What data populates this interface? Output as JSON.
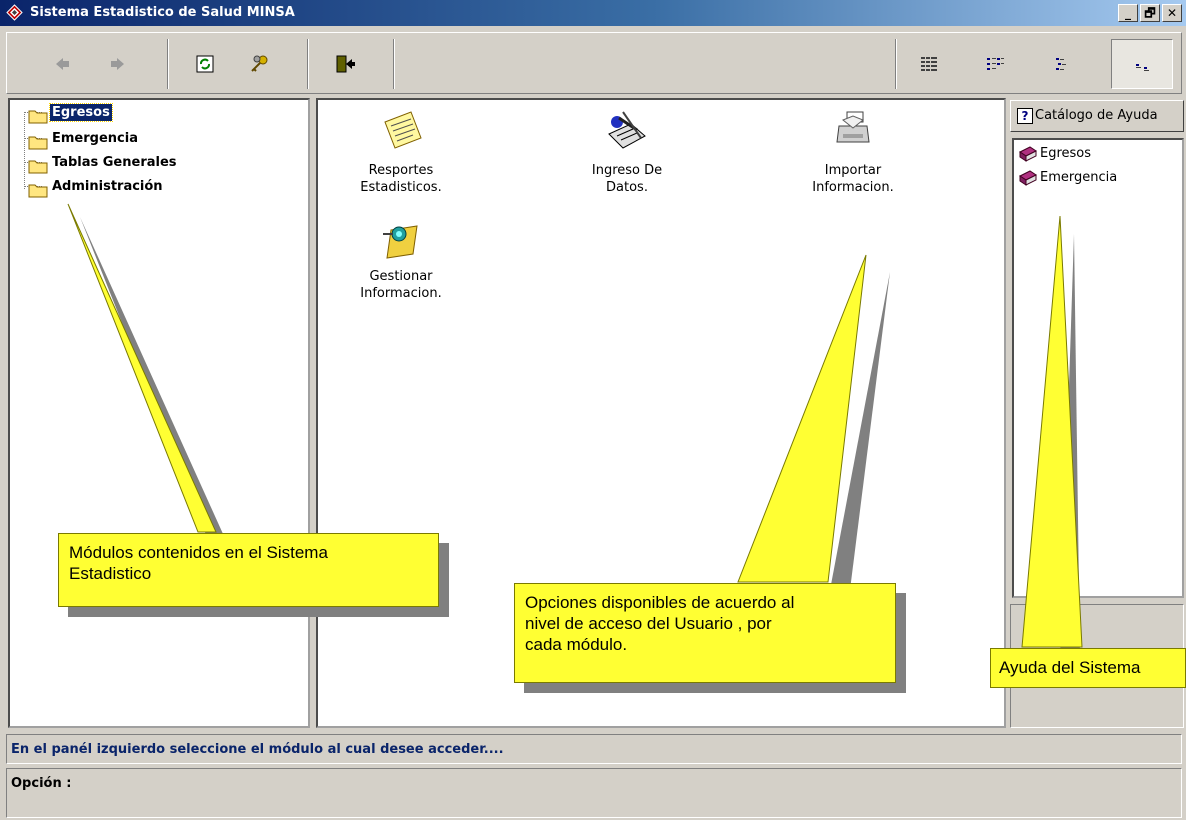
{
  "window": {
    "title": "Sistema Estadistico de Salud  MINSA",
    "minimize_label": "_",
    "maximize_label": "🗗",
    "close_label": "✕"
  },
  "toolbar": {
    "buttons": [
      {
        "name": "back",
        "icon": "arrow-left-icon"
      },
      {
        "name": "forward",
        "icon": "arrow-right-icon"
      },
      {
        "name": "refresh",
        "icon": "refresh-icon"
      },
      {
        "name": "keys",
        "icon": "keys-icon"
      },
      {
        "name": "exit",
        "icon": "exit-door-icon"
      },
      {
        "name": "view-large-icons",
        "icon": "large-icons-icon"
      },
      {
        "name": "view-small-icons",
        "icon": "small-icons-icon"
      },
      {
        "name": "view-list",
        "icon": "list-icon"
      },
      {
        "name": "view-details",
        "icon": "details-icon",
        "pressed": true
      }
    ]
  },
  "tree": {
    "items": [
      {
        "label": "Egresos",
        "selected": true
      },
      {
        "label": "Emergencia"
      },
      {
        "label": "Tablas Generales"
      },
      {
        "label": "Administración"
      }
    ]
  },
  "options": [
    {
      "label_line1": "Resportes",
      "label_line2": "Estadisticos.",
      "icon": "report-note-icon"
    },
    {
      "label_line1": "Ingreso De",
      "label_line2": "Datos.",
      "icon": "data-entry-icon"
    },
    {
      "label_line1": "Importar",
      "label_line2": "Informacion.",
      "icon": "import-printer-icon"
    },
    {
      "label_line1": "Gestionar",
      "label_line2": "Informacion.",
      "icon": "manage-pushpin-icon"
    }
  ],
  "help": {
    "header": "Catálogo de Ayuda",
    "items": [
      {
        "label": "Egresos",
        "icon": "book-icon"
      },
      {
        "label": "Emergencia",
        "icon": "book-icon"
      }
    ]
  },
  "status": {
    "message": "En el panél izquierdo seleccione el módulo al cual desee acceder....",
    "option_label": "Opción :"
  },
  "callouts": {
    "modules_line1": "Módulos contenidos en el Sistema",
    "modules_line2": "Estadistico",
    "options_line1": "Opciones disponibles de acuerdo al",
    "options_line2": "nivel de acceso del Usuario , por",
    "options_line3": "cada módulo.",
    "help": "Ayuda del Sistema"
  },
  "colors": {
    "callout": "#ffff33",
    "title_bar": "#0a246a",
    "status_text": "#0a246a"
  }
}
